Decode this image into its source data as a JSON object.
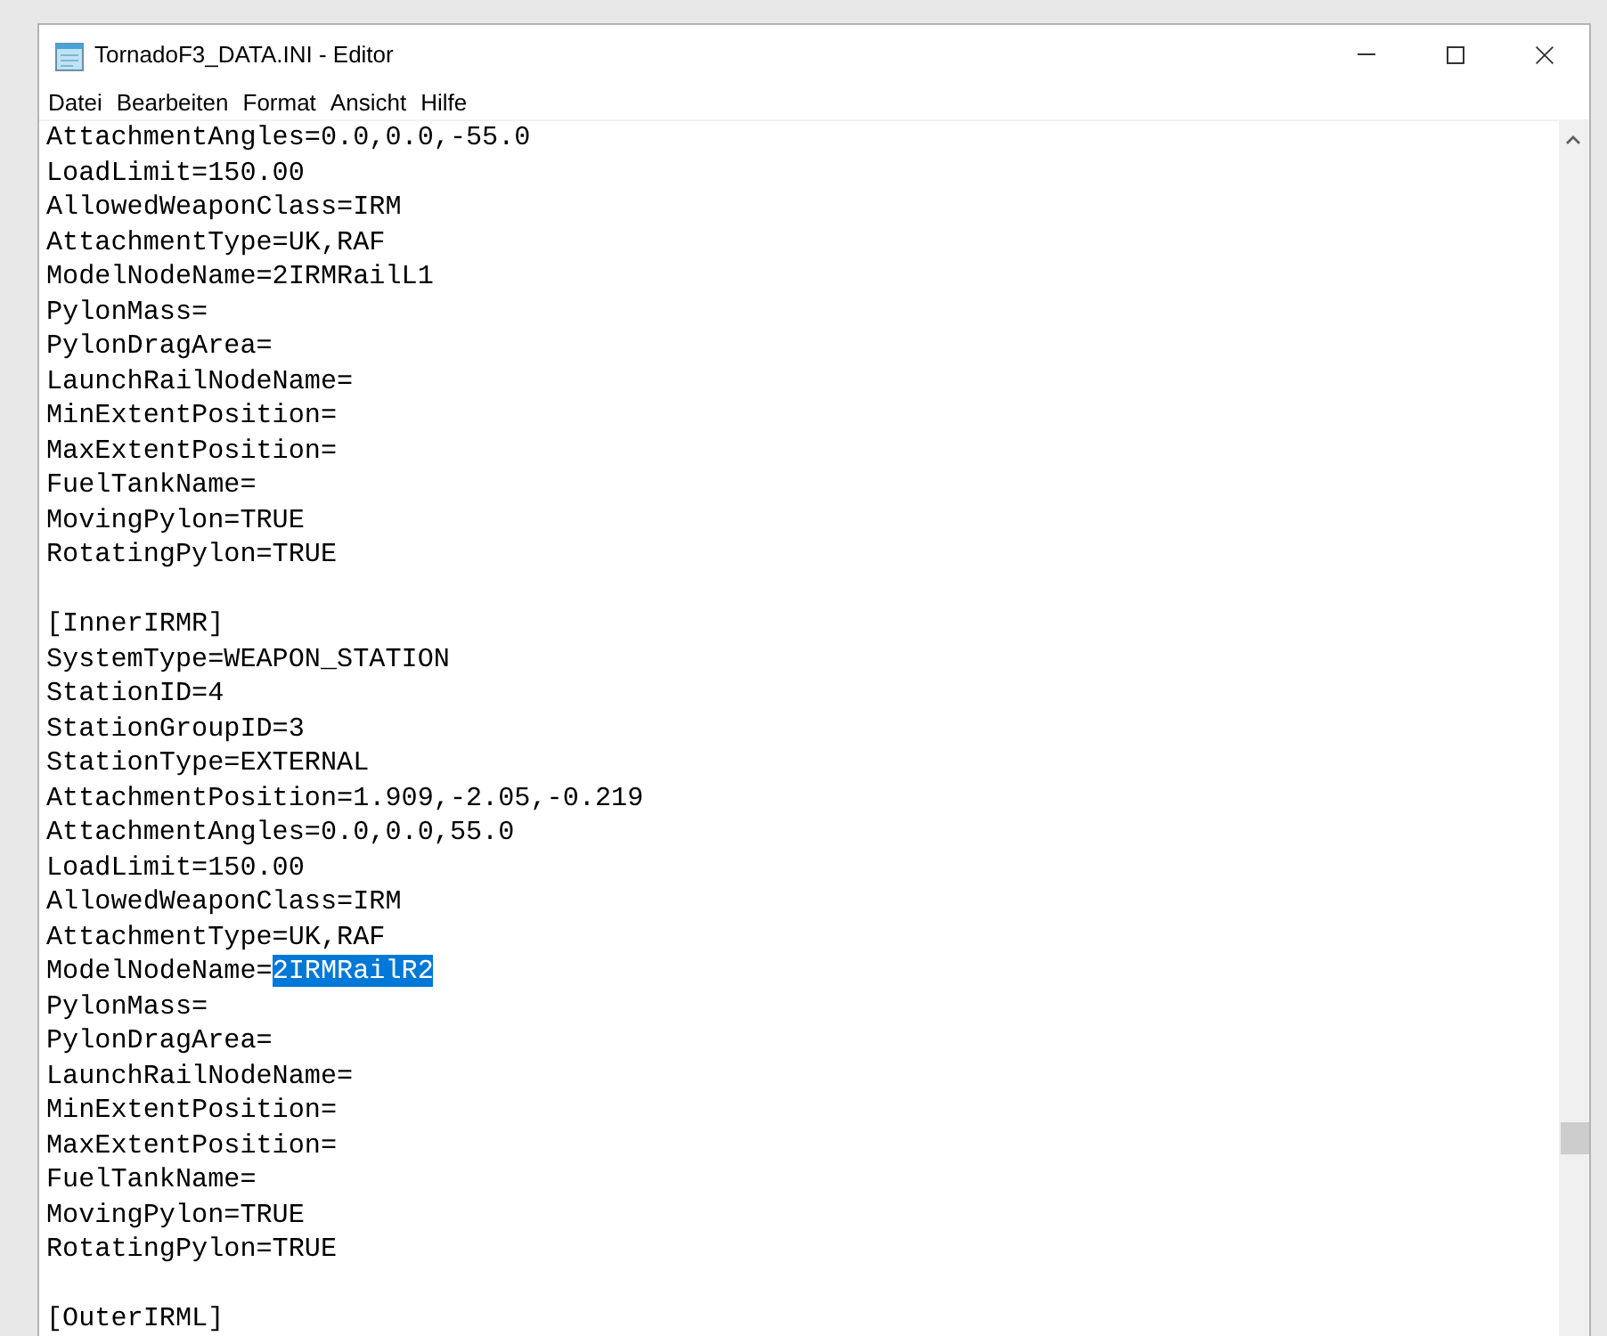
{
  "window": {
    "title": "TornadoF3_DATA.INI - Editor"
  },
  "menu": [
    "Datei",
    "Bearbeiten",
    "Format",
    "Ansicht",
    "Hilfe"
  ],
  "document": {
    "lines": [
      {
        "kind": "text",
        "text": "AttachmentAngles=0.0,0.0,-55.0"
      },
      {
        "kind": "text",
        "text": "LoadLimit=150.00"
      },
      {
        "kind": "text",
        "text": "AllowedWeaponClass=IRM"
      },
      {
        "kind": "text",
        "text": "AttachmentType=UK,RAF"
      },
      {
        "kind": "text",
        "text": "ModelNodeName=2IRMRailL1"
      },
      {
        "kind": "text",
        "text": "PylonMass="
      },
      {
        "kind": "text",
        "text": "PylonDragArea="
      },
      {
        "kind": "text",
        "text": "LaunchRailNodeName="
      },
      {
        "kind": "text",
        "text": "MinExtentPosition="
      },
      {
        "kind": "text",
        "text": "MaxExtentPosition="
      },
      {
        "kind": "text",
        "text": "FuelTankName="
      },
      {
        "kind": "text",
        "text": "MovingPylon=TRUE"
      },
      {
        "kind": "text",
        "text": "RotatingPylon=TRUE"
      },
      {
        "kind": "blank"
      },
      {
        "kind": "text",
        "text": "[InnerIRMR]"
      },
      {
        "kind": "text",
        "text": "SystemType=WEAPON_STATION"
      },
      {
        "kind": "text",
        "text": "StationID=4"
      },
      {
        "kind": "text",
        "text": "StationGroupID=3"
      },
      {
        "kind": "text",
        "text": "StationType=EXTERNAL"
      },
      {
        "kind": "text",
        "text": "AttachmentPosition=1.909,-2.05,-0.219"
      },
      {
        "kind": "text",
        "text": "AttachmentAngles=0.0,0.0,55.0"
      },
      {
        "kind": "text",
        "text": "LoadLimit=150.00"
      },
      {
        "kind": "text",
        "text": "AllowedWeaponClass=IRM"
      },
      {
        "kind": "text",
        "text": "AttachmentType=UK,RAF"
      },
      {
        "kind": "text",
        "text": "ModelNodeName=",
        "selected_text": "2IRMRailR2"
      },
      {
        "kind": "text",
        "text": "PylonMass="
      },
      {
        "kind": "text",
        "text": "PylonDragArea="
      },
      {
        "kind": "text",
        "text": "LaunchRailNodeName="
      },
      {
        "kind": "text",
        "text": "MinExtentPosition="
      },
      {
        "kind": "text",
        "text": "MaxExtentPosition="
      },
      {
        "kind": "text",
        "text": "FuelTankName="
      },
      {
        "kind": "text",
        "text": "MovingPylon=TRUE"
      },
      {
        "kind": "text",
        "text": "RotatingPylon=TRUE"
      },
      {
        "kind": "blank"
      },
      {
        "kind": "text",
        "text": "[OuterIRML]"
      }
    ]
  }
}
